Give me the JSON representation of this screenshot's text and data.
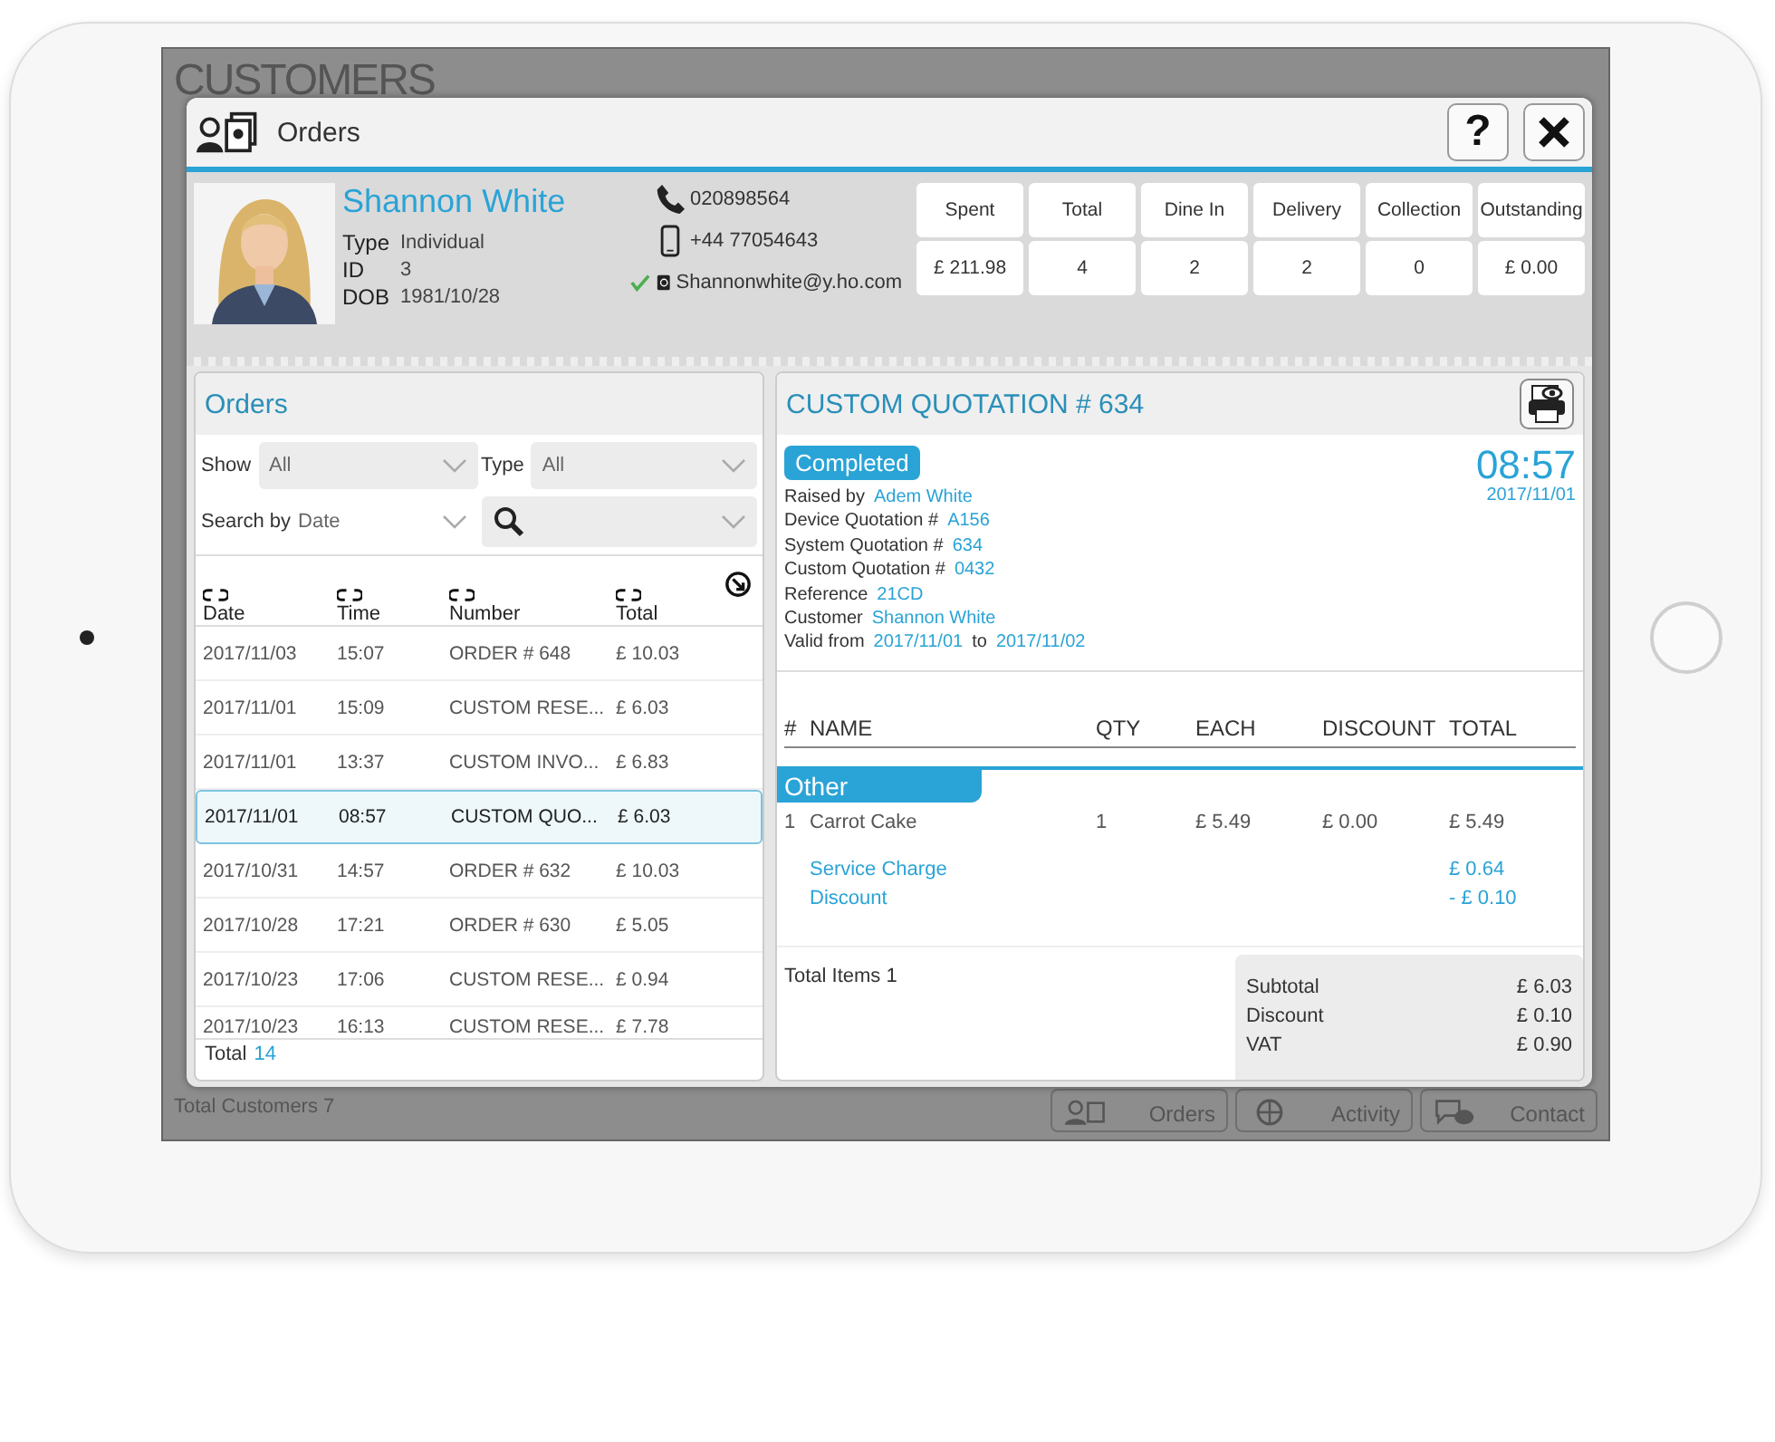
{
  "background": {
    "title": "CUSTOMERS",
    "footer": "Total Customers 7",
    "tabs": [
      {
        "kind": "orders",
        "label": "Orders"
      },
      {
        "kind": "activity",
        "label": "Activity"
      },
      {
        "kind": "contact",
        "label": "Contact"
      }
    ]
  },
  "dialog": {
    "title": "Orders",
    "help": "?"
  },
  "customer": {
    "name": "Shannon White",
    "fields": [
      {
        "label": "Type",
        "value": "Individual"
      },
      {
        "label": "ID",
        "value": "3"
      },
      {
        "label": "DOB",
        "value": "1981/10/28"
      }
    ],
    "contacts": [
      {
        "kind": "phone",
        "value": "020898564",
        "verified": false
      },
      {
        "kind": "mobile",
        "value": "+44 77054643",
        "verified": false
      },
      {
        "kind": "email",
        "value": "Shannonwhite@y.ho.com",
        "verified": true
      }
    ]
  },
  "stats": [
    {
      "label": "Spent",
      "value": "£ 211.98"
    },
    {
      "label": "Total",
      "value": "4"
    },
    {
      "label": "Dine In",
      "value": "2"
    },
    {
      "label": "Delivery",
      "value": "2"
    },
    {
      "label": "Collection",
      "value": "0"
    },
    {
      "label": "Outstanding",
      "value": "£ 0.00"
    }
  ],
  "orders": {
    "title": "Orders",
    "filters": [
      {
        "label": "Show",
        "value": "All"
      },
      {
        "label": "Type",
        "value": "All"
      },
      {
        "label": "Search by",
        "value": "Date"
      }
    ],
    "columns": [
      "Date",
      "Time",
      "Number",
      "Total"
    ],
    "rows": [
      {
        "date": "2017/11/03",
        "time": "15:07",
        "number": "ORDER # 648",
        "total": "£ 10.03",
        "selected": false
      },
      {
        "date": "2017/11/01",
        "time": "15:09",
        "number": "CUSTOM RESE...",
        "total": "£ 6.03",
        "selected": false
      },
      {
        "date": "2017/11/01",
        "time": "13:37",
        "number": "CUSTOM INVO...",
        "total": "£ 6.83",
        "selected": false
      },
      {
        "date": "2017/11/01",
        "time": "08:57",
        "number": "CUSTOM QUO...",
        "total": "£ 6.03",
        "selected": true
      },
      {
        "date": "2017/10/31",
        "time": "14:57",
        "number": "ORDER # 632",
        "total": "£ 10.03",
        "selected": false
      },
      {
        "date": "2017/10/28",
        "time": "17:21",
        "number": "ORDER # 630",
        "total": "£ 5.05",
        "selected": false
      },
      {
        "date": "2017/10/23",
        "time": "17:06",
        "number": "CUSTOM RESE...",
        "total": "£ 0.94",
        "selected": false
      },
      {
        "date": "2017/10/23",
        "time": "16:13",
        "number": "CUSTOM RESE...",
        "total": "£ 7.78",
        "selected": false
      }
    ],
    "total_label": "Total",
    "total_value": "14"
  },
  "quotation": {
    "title": "CUSTOM QUOTATION # 634",
    "status": "Completed",
    "time": "08:57",
    "date": "2017/11/01",
    "details": [
      {
        "label": "Raised by",
        "value": "Adem White"
      },
      {
        "label": "Device Quotation #",
        "value": "A156"
      },
      {
        "label": "System Quotation #",
        "value": "634"
      },
      {
        "label": "Custom Quotation #",
        "value": "0432"
      },
      {
        "label": "Reference",
        "value": "21CD"
      },
      {
        "label": "Customer",
        "value": "Shannon White"
      }
    ],
    "validity": {
      "label": "Valid from",
      "from": "2017/11/01",
      "joiner": "to",
      "to": "2017/11/02"
    },
    "columns": [
      "#",
      "NAME",
      "QTY",
      "EACH",
      "DISCOUNT",
      "TOTAL"
    ],
    "category": "Other",
    "items": [
      {
        "no": "1",
        "name": "Carrot Cake",
        "qty": "1",
        "each": "£ 5.49",
        "discount": "£ 0.00",
        "total": "£ 5.49"
      }
    ],
    "charges": [
      {
        "label": "Service Charge",
        "value": "£ 0.64"
      },
      {
        "label": "Discount",
        "value": "- £ 0.10"
      }
    ],
    "total_items": "Total Items 1",
    "summary": [
      {
        "label": "Subtotal",
        "value": "£ 6.03"
      },
      {
        "label": "Discount",
        "value": "£ 0.10"
      },
      {
        "label": "VAT",
        "value": "£ 0.90"
      }
    ]
  }
}
